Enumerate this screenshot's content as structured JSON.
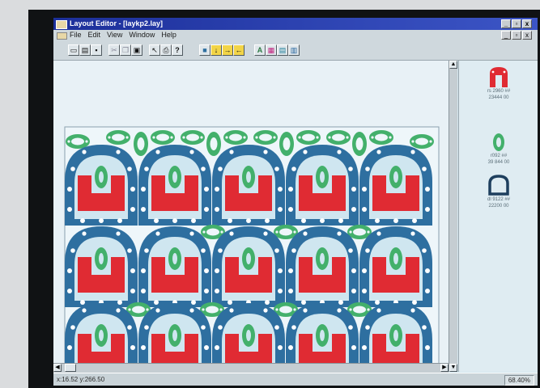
{
  "window": {
    "title": "Layout Editor - [laykp2.lay]",
    "controls": [
      "_",
      "▫",
      "x"
    ],
    "doc_controls": [
      "_",
      "▫",
      "x"
    ]
  },
  "menu": [
    "File",
    "Edit",
    "View",
    "Window",
    "Help"
  ],
  "toolbar": {
    "buttons": [
      {
        "name": "new-button",
        "glyph": "▭"
      },
      {
        "name": "open-button",
        "glyph": "▤"
      },
      {
        "name": "save-button",
        "glyph": "▪"
      },
      {
        "name": "cut-button",
        "glyph": "✂"
      },
      {
        "name": "copy-button",
        "glyph": "❐"
      },
      {
        "name": "paste-button",
        "glyph": "▣"
      },
      {
        "name": "select-button",
        "glyph": "↖"
      },
      {
        "name": "print-button",
        "glyph": "⎙"
      },
      {
        "name": "help-button",
        "glyph": "?"
      },
      {
        "name": "fill-button",
        "glyph": "■"
      },
      {
        "name": "move-down-button",
        "glyph": "↓"
      },
      {
        "name": "move-right-button",
        "glyph": "→"
      },
      {
        "name": "move-left-button",
        "glyph": "←"
      },
      {
        "name": "tool-a-button",
        "glyph": "A"
      },
      {
        "name": "tool-b-button",
        "glyph": "▦"
      },
      {
        "name": "tool-c-button",
        "glyph": "▤"
      },
      {
        "name": "tool-d-button",
        "glyph": "▥"
      }
    ]
  },
  "parts": [
    {
      "label_1": "rs 2960 ##",
      "label_2": "23444 00",
      "color": "#e02b33",
      "shape": "u-part"
    },
    {
      "label_1": "r092 ##",
      "label_2": "39 844 00",
      "color": "#43b06b",
      "shape": "oval-part"
    },
    {
      "label_1": "dl 9122 ##",
      "label_2": "22200 00",
      "color": "#2f6f9f",
      "shape": "d-part"
    }
  ],
  "status": {
    "coords": "x:16.52 y:266.50",
    "zoom": "68.40%"
  },
  "colors": {
    "gasket_blue": "#2e6fa0",
    "insert_red": "#e02b33",
    "green_part": "#43b06b",
    "title_bar": "#1c2f9a"
  }
}
